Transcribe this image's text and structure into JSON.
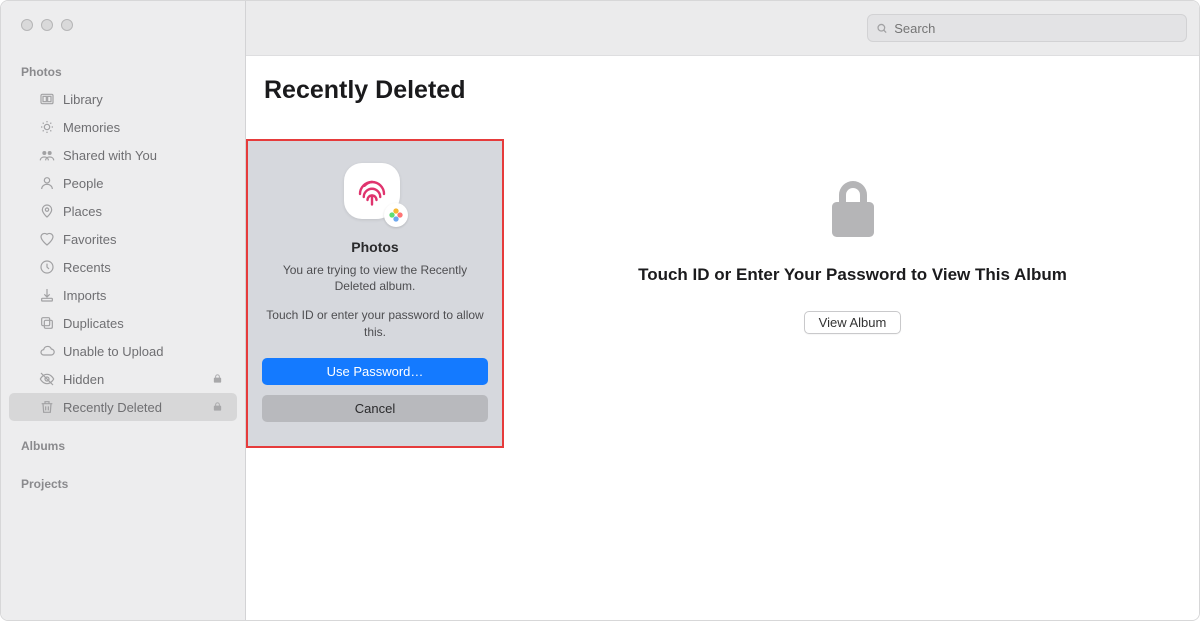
{
  "sidebar": {
    "sections": {
      "photos_label": "Photos",
      "albums_label": "Albums",
      "projects_label": "Projects"
    },
    "items": [
      {
        "label": "Library",
        "icon": "library-icon",
        "locked": false,
        "selected": false
      },
      {
        "label": "Memories",
        "icon": "memories-icon",
        "locked": false,
        "selected": false
      },
      {
        "label": "Shared with You",
        "icon": "shared-icon",
        "locked": false,
        "selected": false
      },
      {
        "label": "People",
        "icon": "people-icon",
        "locked": false,
        "selected": false
      },
      {
        "label": "Places",
        "icon": "places-icon",
        "locked": false,
        "selected": false
      },
      {
        "label": "Favorites",
        "icon": "favorites-icon",
        "locked": false,
        "selected": false
      },
      {
        "label": "Recents",
        "icon": "recents-icon",
        "locked": false,
        "selected": false
      },
      {
        "label": "Imports",
        "icon": "imports-icon",
        "locked": false,
        "selected": false
      },
      {
        "label": "Duplicates",
        "icon": "duplicates-icon",
        "locked": false,
        "selected": false
      },
      {
        "label": "Unable to Upload",
        "icon": "cloud-icon",
        "locked": false,
        "selected": false
      },
      {
        "label": "Hidden",
        "icon": "hidden-icon",
        "locked": true,
        "selected": false
      },
      {
        "label": "Recently Deleted",
        "icon": "trash-icon",
        "locked": true,
        "selected": true
      }
    ]
  },
  "search": {
    "placeholder": "Search"
  },
  "main": {
    "title": "Recently Deleted",
    "empty_heading": "Touch ID or Enter Your Password to View This Album",
    "view_album_label": "View Album"
  },
  "dialog": {
    "app_name": "Photos",
    "message": "You are trying to view the Recently Deleted album.",
    "sub_message": "Touch ID or enter your password to allow this.",
    "primary_label": "Use Password…",
    "secondary_label": "Cancel"
  }
}
